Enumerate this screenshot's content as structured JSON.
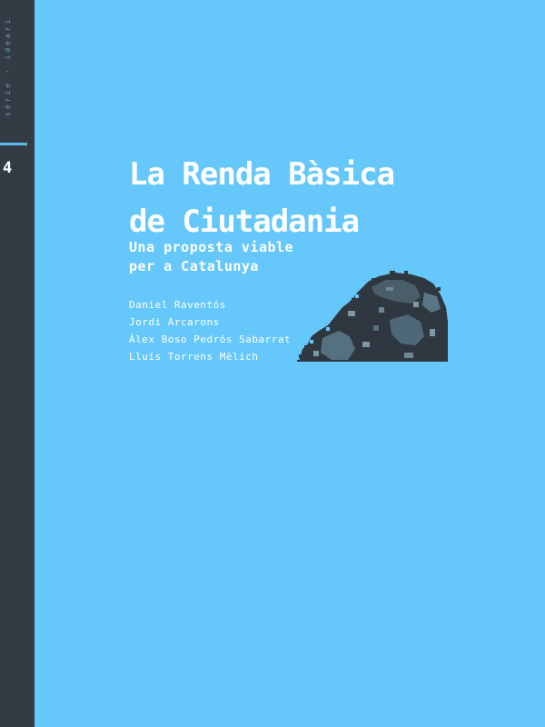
{
  "spine": {
    "series_text": "sèrie · ideari",
    "number": "4"
  },
  "cover": {
    "title_lines": [
      "La Renda Bàsica",
      "de Ciutadania"
    ],
    "subtitle_lines": [
      "Una proposta viable",
      "per a Catalunya"
    ],
    "author_lines": [
      "Daniel Raventós",
      "Jordi Arcarons",
      "Àlex Boso Pedrós Sabarrat",
      "Lluís Torrens Mèlich"
    ]
  },
  "colors": {
    "background": "#66c8fa",
    "spine": "#333b44",
    "text": "#ffffff",
    "illustration_dark": "#2f3840",
    "illustration_mid": "#4e6878"
  },
  "icons": {
    "illustration": "pixelated-rock-illustration"
  }
}
